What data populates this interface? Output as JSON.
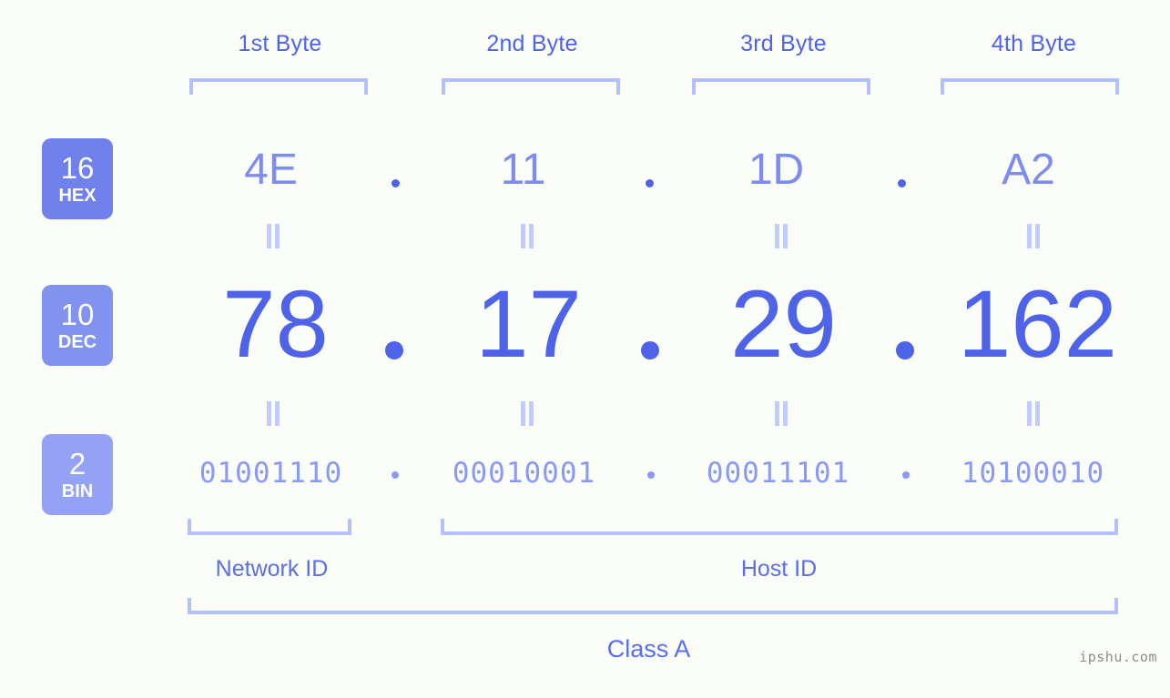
{
  "watermark": "ipshu.com",
  "byte_headers": [
    {
      "label": "1st Byte"
    },
    {
      "label": "2nd Byte"
    },
    {
      "label": "3rd Byte"
    },
    {
      "label": "4th Byte"
    }
  ],
  "radix_badges": [
    {
      "num": "16",
      "abbr": "HEX",
      "color": "#7081ec"
    },
    {
      "num": "10",
      "abbr": "DEC",
      "color": "#8292ef"
    },
    {
      "num": "2",
      "abbr": "BIN",
      "color": "#93a2f4"
    }
  ],
  "rows": {
    "hex": {
      "values": [
        "4E",
        "11",
        "1D",
        "A2"
      ],
      "separator": "."
    },
    "dec": {
      "values": [
        "78",
        "17",
        "29",
        "162"
      ],
      "separator": "."
    },
    "bin": {
      "values": [
        "01001110",
        "00010001",
        "00011101",
        "10100010"
      ],
      "separator": "."
    }
  },
  "equality_marks": {
    "hex_to_dec": [
      "‖",
      "‖",
      "‖",
      "‖"
    ],
    "dec_to_bin": [
      "‖",
      "‖",
      "‖",
      "‖"
    ]
  },
  "segments": {
    "network_id": "Network ID",
    "host_id": "Host ID",
    "class": "Class A"
  },
  "colors": {
    "background": "#fbfdf9",
    "bracket": "#b4bffb",
    "header_text": "#4f63e8",
    "hex_text": "#7d8cf0",
    "dec_text": "#4f63e8",
    "bin_text": "#8a99f2",
    "caption_text": "#5a6ee9",
    "equality_mark": "#c2ccfc",
    "watermark_text": "#8c8c8c"
  }
}
